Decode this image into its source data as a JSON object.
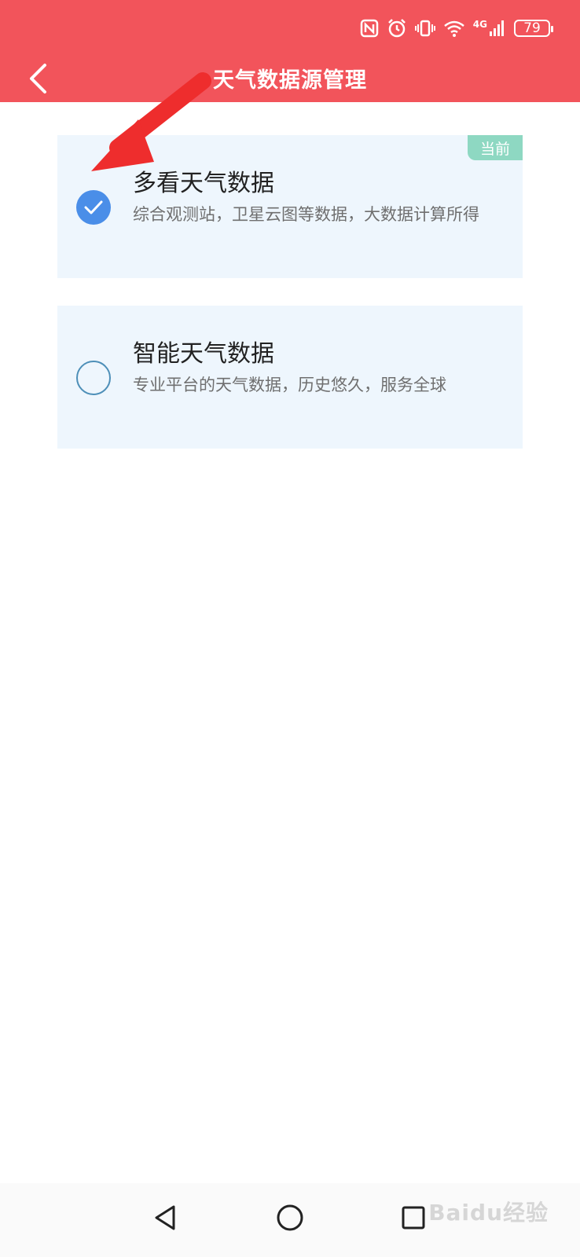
{
  "status_bar": {
    "battery": "79",
    "network": "4G",
    "icons": [
      "nfc-icon",
      "alarm-icon",
      "vibrate-icon",
      "wifi-icon",
      "signal-icon",
      "battery-icon"
    ]
  },
  "header": {
    "title": "天气数据源管理",
    "back_icon": "chevron-left-icon",
    "color": "#f2545b"
  },
  "sources": [
    {
      "title": "多看天气数据",
      "description": "综合观测站，卫星云图等数据，大数据计算所得",
      "selected": true,
      "badge": "当前"
    },
    {
      "title": "智能天气数据",
      "description": "专业平台的天气数据，历史悠久，服务全球",
      "selected": false
    }
  ],
  "colors": {
    "card_bg": "#eef6fd",
    "radio_checked": "#4a8ee8",
    "badge": "#8ed8c2",
    "arrow": "#ee2d2d"
  },
  "nav_bar": {
    "icons": [
      "back-triangle-icon",
      "home-circle-icon",
      "recents-square-icon"
    ]
  },
  "watermark": "Baidu经验"
}
